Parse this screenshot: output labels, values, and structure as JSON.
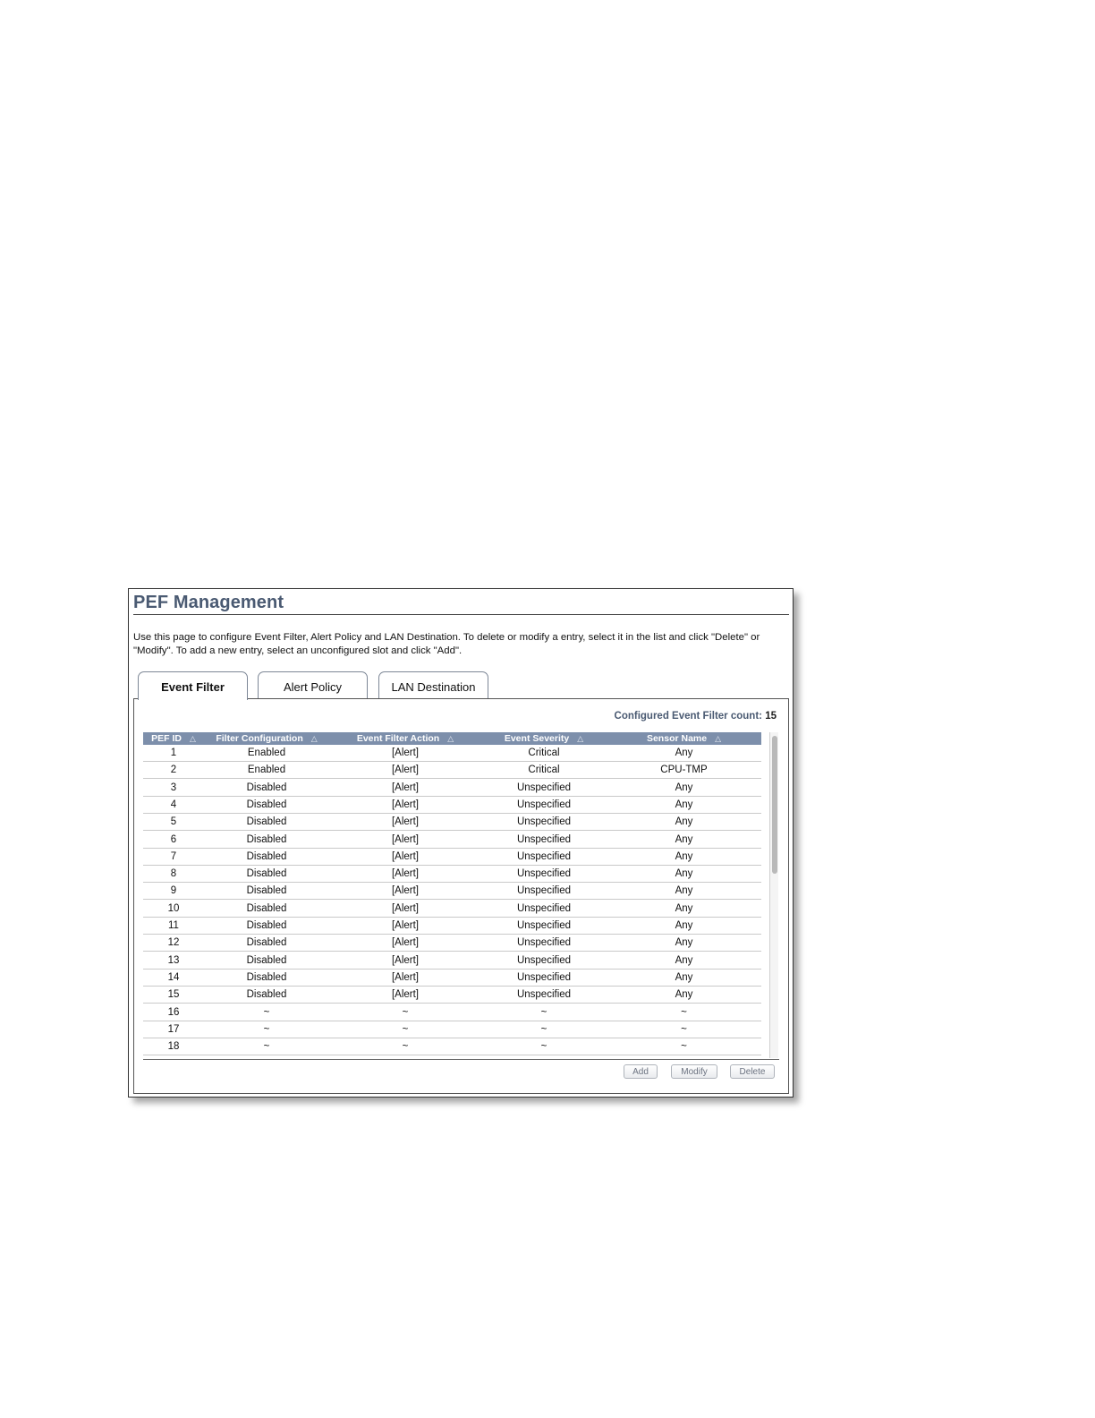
{
  "page": {
    "title": "PEF Management",
    "description": "Use this page to configure Event Filter, Alert Policy and LAN Destination. To delete or modify a entry, select it in the list and click \"Delete\" or \"Modify\". To add a new entry, select an unconfigured slot and click \"Add\"."
  },
  "tabs": [
    {
      "label": "Event Filter",
      "active": true
    },
    {
      "label": "Alert Policy",
      "active": false
    },
    {
      "label": "LAN Destination",
      "active": false
    }
  ],
  "count": {
    "label": "Configured Event Filter count:",
    "value": "15"
  },
  "table": {
    "sort_indicator": "△",
    "columns": [
      "PEF ID",
      "Filter Configuration",
      "Event Filter Action",
      "Event Severity",
      "Sensor Name"
    ],
    "rows": [
      [
        "1",
        "Enabled",
        "[Alert]",
        "Critical",
        "Any"
      ],
      [
        "2",
        "Enabled",
        "[Alert]",
        "Critical",
        "CPU-TMP"
      ],
      [
        "3",
        "Disabled",
        "[Alert]",
        "Unspecified",
        "Any"
      ],
      [
        "4",
        "Disabled",
        "[Alert]",
        "Unspecified",
        "Any"
      ],
      [
        "5",
        "Disabled",
        "[Alert]",
        "Unspecified",
        "Any"
      ],
      [
        "6",
        "Disabled",
        "[Alert]",
        "Unspecified",
        "Any"
      ],
      [
        "7",
        "Disabled",
        "[Alert]",
        "Unspecified",
        "Any"
      ],
      [
        "8",
        "Disabled",
        "[Alert]",
        "Unspecified",
        "Any"
      ],
      [
        "9",
        "Disabled",
        "[Alert]",
        "Unspecified",
        "Any"
      ],
      [
        "10",
        "Disabled",
        "[Alert]",
        "Unspecified",
        "Any"
      ],
      [
        "11",
        "Disabled",
        "[Alert]",
        "Unspecified",
        "Any"
      ],
      [
        "12",
        "Disabled",
        "[Alert]",
        "Unspecified",
        "Any"
      ],
      [
        "13",
        "Disabled",
        "[Alert]",
        "Unspecified",
        "Any"
      ],
      [
        "14",
        "Disabled",
        "[Alert]",
        "Unspecified",
        "Any"
      ],
      [
        "15",
        "Disabled",
        "[Alert]",
        "Unspecified",
        "Any"
      ],
      [
        "16",
        "~",
        "~",
        "~",
        "~"
      ],
      [
        "17",
        "~",
        "~",
        "~",
        "~"
      ],
      [
        "18",
        "~",
        "~",
        "~",
        "~"
      ]
    ]
  },
  "buttons": {
    "add": "Add",
    "modify": "Modify",
    "delete": "Delete"
  },
  "colors": {
    "header_bg": "#7d8fab",
    "title": "#4a5a72"
  }
}
